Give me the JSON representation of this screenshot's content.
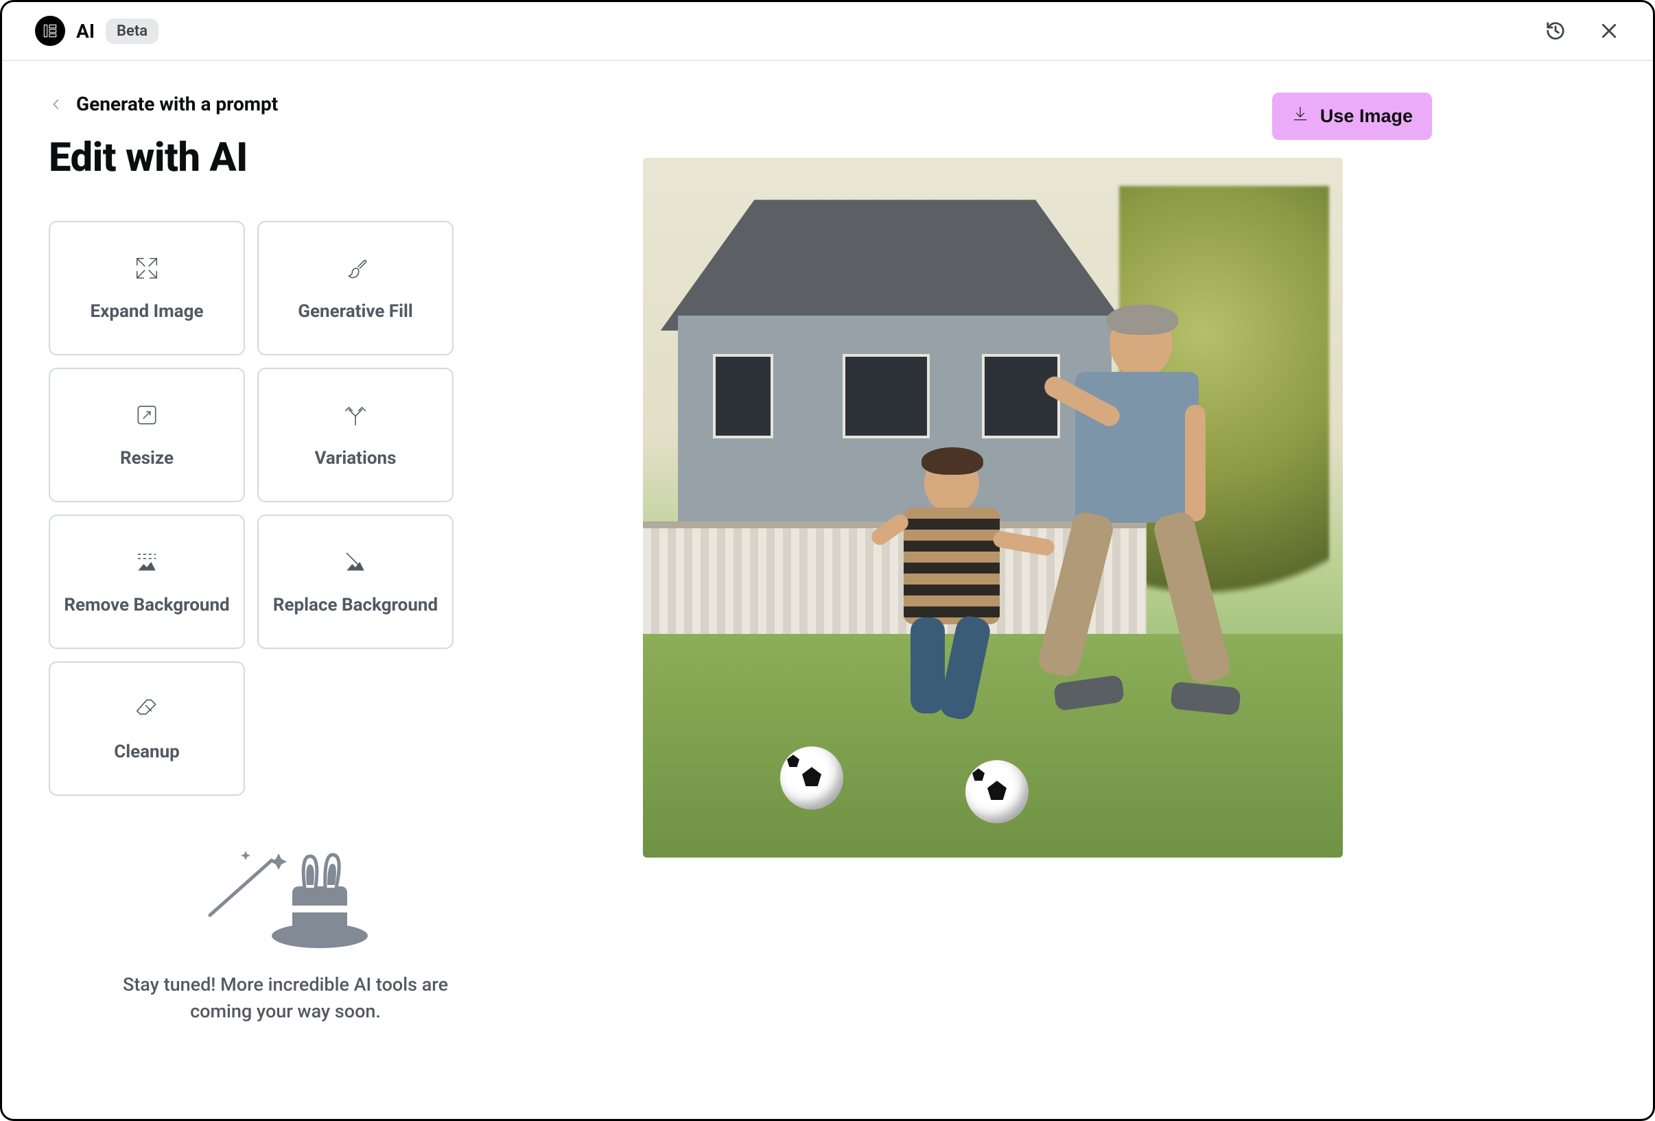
{
  "header": {
    "brand": "AI",
    "badge": "Beta"
  },
  "breadcrumb": {
    "label": "Generate with a prompt"
  },
  "page_title": "Edit with AI",
  "use_image_label": "Use Image",
  "tools": [
    {
      "name": "expand-image",
      "label": "Expand Image",
      "icon": "expand-arrows-icon"
    },
    {
      "name": "generative-fill",
      "label": "Generative Fill",
      "icon": "brush-icon"
    },
    {
      "name": "resize",
      "label": "Resize",
      "icon": "resize-icon"
    },
    {
      "name": "variations",
      "label": "Variations",
      "icon": "branch-icon"
    },
    {
      "name": "remove-background",
      "label": "Remove Background",
      "icon": "remove-bg-icon"
    },
    {
      "name": "replace-background",
      "label": "Replace Background",
      "icon": "replace-bg-icon"
    },
    {
      "name": "cleanup",
      "label": "Cleanup",
      "icon": "eraser-icon"
    }
  ],
  "promo_text": "Stay tuned! More incredible AI tools are coming your way soon.",
  "preview_alt": "A man and a boy playing soccer on a lawn in front of a house"
}
